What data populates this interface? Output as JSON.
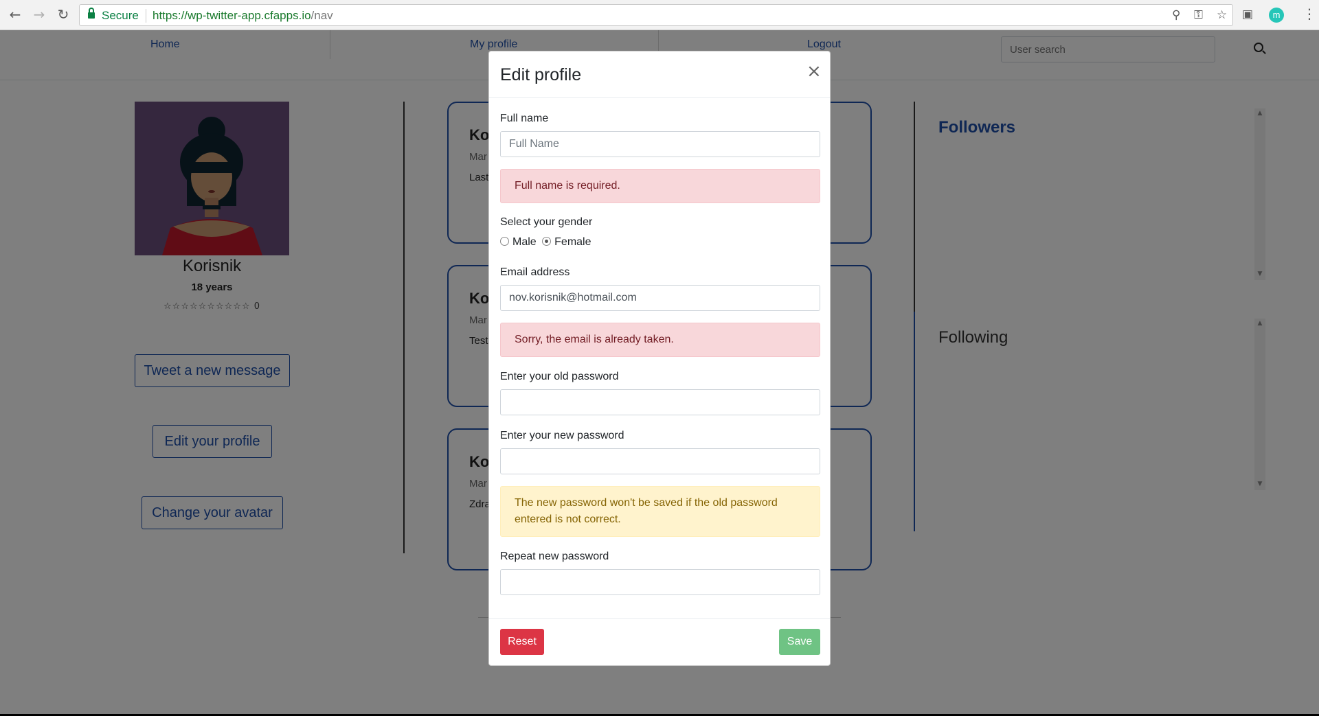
{
  "browser": {
    "secure_label": "Secure",
    "url_host": "https://wp-twitter-app.cfapps.io",
    "url_path": "/nav",
    "profile_initial": "m"
  },
  "nav": {
    "home": "Home",
    "my_profile": "My profile",
    "logout": "Logout",
    "search_placeholder": "User search"
  },
  "profile": {
    "name": "Korisnik",
    "age": "18 years",
    "stars": "☆☆☆☆☆☆☆☆☆☆",
    "rating": "0",
    "tweet_button": "Tweet a new message",
    "edit_button": "Edit your profile",
    "avatar_button": "Change your avatar"
  },
  "tweets": [
    {
      "name": "Ko",
      "meta": "Mar",
      "text": "Last"
    },
    {
      "name": "Ko",
      "meta": "Mar",
      "text": "Test"
    },
    {
      "name": "Ko",
      "meta": "Mar",
      "text": "Zdra"
    }
  ],
  "sidebar": {
    "followers_title": "Followers",
    "following_title": "Following"
  },
  "modal": {
    "title": "Edit profile",
    "close": "×",
    "full_name_label": "Full name",
    "full_name_placeholder": "Full Name",
    "full_name_value": "",
    "full_name_error": "Full name is required.",
    "gender_label": "Select your gender",
    "gender_male": "Male",
    "gender_female": "Female",
    "gender_selected": "Female",
    "email_label": "Email address",
    "email_value": "nov.korisnik@hotmail.com",
    "email_error": "Sorry, the email is already taken.",
    "old_password_label": "Enter your old password",
    "new_password_label": "Enter your new password",
    "password_warning": "The new password won't be saved if the old password entered is not correct.",
    "repeat_password_label": "Repeat new password",
    "reset_button": "Reset",
    "save_button": "Save"
  }
}
